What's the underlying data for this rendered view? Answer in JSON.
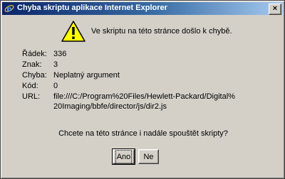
{
  "window": {
    "title": "Chyba skriptu aplikace Internet Explorer",
    "close_glyph": "×",
    "app_icon": "internet-explorer-icon"
  },
  "message": {
    "icon": "warning-icon",
    "text": "Ve skriptu na této stránce došlo k chybě."
  },
  "details": {
    "line_label": "Řádek:",
    "line_value": "336",
    "char_label": "Znak:",
    "char_value": "3",
    "error_label": "Chyba:",
    "error_value": "Neplatný argument",
    "code_label": "Kód:",
    "code_value": "0",
    "url_label": "URL:",
    "url_line1": "file:///C:/Program%20Files/Hewlett-Packard/Digital%",
    "url_line2": "20Imaging/bbfe/director/js/dir2.js"
  },
  "question": "Chcete na této stránce i nadále spouštět skripty?",
  "buttons": {
    "yes": "Ano",
    "no": "Ne"
  },
  "colors": {
    "title_start": "#0a246a",
    "title_end": "#a6caf0",
    "face": "#d4d0c8",
    "warning_yellow": "#ffff00"
  }
}
